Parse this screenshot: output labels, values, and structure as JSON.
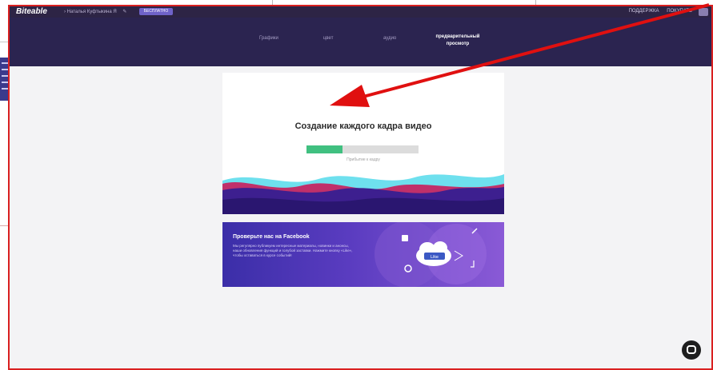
{
  "app": {
    "logo": "Biteable",
    "breadcrumb": "› Наталья Куфтыкина Я",
    "badge_label": "БЕСПЛАТНО",
    "top_right": [
      "ПОДДЕРЖКА",
      "ПОКУПАТЬ"
    ]
  },
  "steps": [
    {
      "label": "Графики"
    },
    {
      "label": "цвет"
    },
    {
      "label": "аудио"
    },
    {
      "label": "предварительный просмотр",
      "active": true
    }
  ],
  "preview": {
    "title": "Создание каждого кадра видео",
    "progress_percent": 32,
    "progress_caption": "Прибытие к кадру"
  },
  "banner": {
    "title": "Проверьте нас на Facebook",
    "text": "Мы регулярно публикуем интересные материалы, новинки и анонсы, наши обновления функций и голубой заставки. Нажмите кнопку «Like», чтобы оставаться в курсе событий!",
    "like_label": "Like"
  },
  "colors": {
    "topbar": "#2d2445",
    "stepbar": "#2b2450",
    "progress_fill": "#40c080",
    "annotation": "#e01010",
    "frame_border": "#d92020"
  },
  "icons": [
    "pen-icon",
    "avatar-icon",
    "chat-icon",
    "arrow-annotation-icon",
    "cloud-icon"
  ]
}
